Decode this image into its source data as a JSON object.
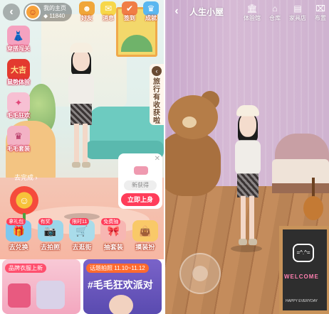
{
  "left": {
    "header": {
      "back_icon": "chevron-left-icon",
      "home_title": "我的主页",
      "coins": "11840"
    },
    "top_icons": [
      {
        "label": "好友",
        "icon": "friends-icon",
        "color": "#f0a63a"
      },
      {
        "label": "消息",
        "icon": "message-icon",
        "color": "#f7d74a"
      },
      {
        "label": "签到",
        "icon": "checkin-icon",
        "color": "#f07d46"
      },
      {
        "label": "成就",
        "icon": "trophy-icon",
        "color": "#5ab7f0"
      }
    ],
    "side_items": [
      {
        "label": "穿搭闯关",
        "icon": "fashion-challenge-icon",
        "color": "#f5a2c0",
        "glyph": "👗"
      },
      {
        "label": "鼠势体验",
        "icon": "fortune-icon",
        "color": "#e33a2f",
        "glyph": "大吉"
      },
      {
        "label": "毛毛狂欢",
        "icon": "carnival-icon",
        "color": "#f7c0d3",
        "glyph": "✦"
      },
      {
        "label": "毛毛套装",
        "icon": "outfit-set-icon",
        "color": "#f3b2c5",
        "glyph": "♛"
      }
    ],
    "travel_tab": {
      "text": "旅行有收获啦",
      "icon": "arrow-left-icon"
    },
    "go_finish": "去完成",
    "new_item_card": {
      "got_label": "新获得",
      "wear_button": "立即上身",
      "close_icon": "close-icon"
    },
    "actions": [
      {
        "label": "去兑换",
        "tag": "拿礼包",
        "icon": "exchange-icon",
        "color": "#7fc8f0"
      },
      {
        "label": "去拍照",
        "tag": "有奖",
        "icon": "camera-icon",
        "color": "#9bd6ea"
      },
      {
        "label": "去逛街",
        "tag": "限时11",
        "icon": "shopping-icon",
        "color": "#a9dcea"
      },
      {
        "label": "抽套装",
        "tag": "免费抽",
        "icon": "gacha-icon",
        "color": "#f7b6b2"
      },
      {
        "label": "摸装扮",
        "tag": "",
        "icon": "dressup-icon",
        "color": "#f9c968"
      }
    ],
    "banners": [
      {
        "tag": "品牌衣服上新"
      },
      {
        "tag": "话题拍照",
        "date": "11.10~11.12",
        "title": "#毛毛狂欢派对"
      }
    ]
  },
  "right": {
    "header": {
      "back_icon": "chevron-left-icon",
      "title": "人生小屋"
    },
    "buttons": [
      {
        "label": "体验馆",
        "icon": "museum-icon"
      },
      {
        "label": "仓库",
        "icon": "warehouse-icon"
      },
      {
        "label": "家具店",
        "icon": "furniture-store-icon"
      },
      {
        "label": "布置",
        "icon": "arrange-icon"
      }
    ],
    "board": {
      "cat_text": "=^.^=",
      "welcome": "WELCOME",
      "happy": "HAPPY EVERYDAY"
    }
  }
}
